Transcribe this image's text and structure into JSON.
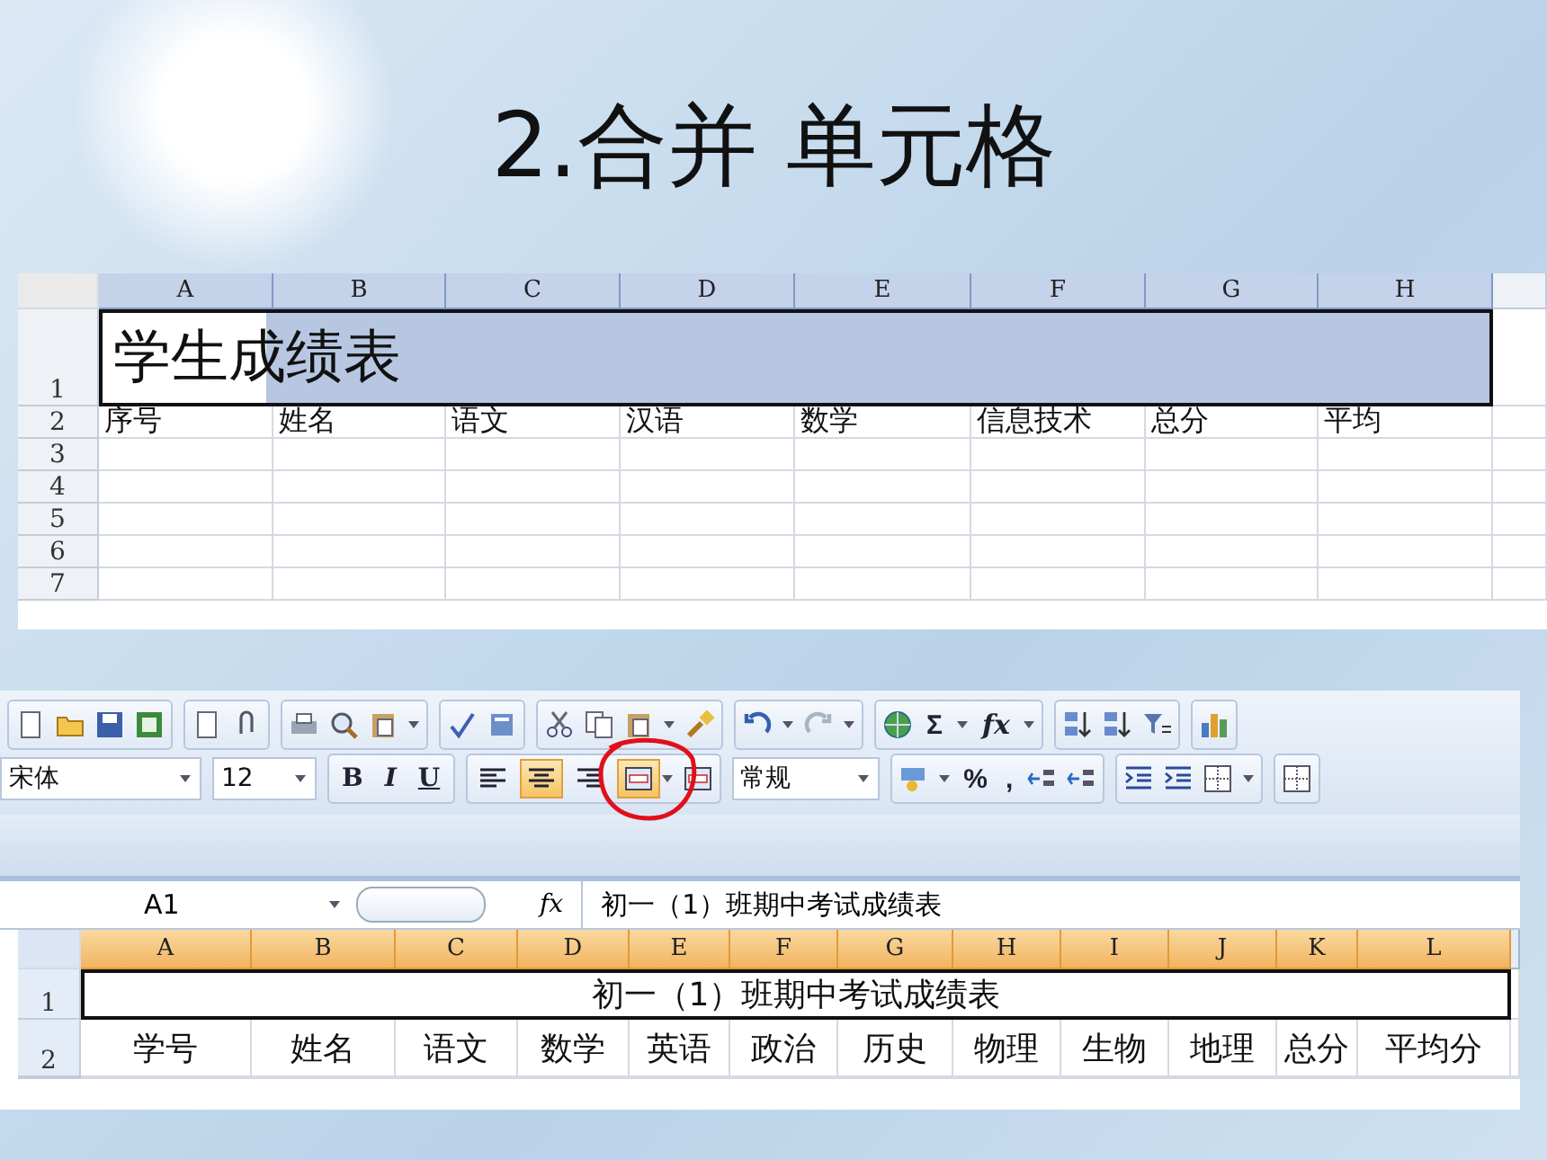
{
  "title": "2.合并 单元格",
  "sheet_1": {
    "columns": [
      {
        "label": "A",
        "selected": true
      },
      {
        "label": "B",
        "selected": true
      },
      {
        "label": "C",
        "selected": true
      },
      {
        "label": "D",
        "selected": true
      },
      {
        "label": "E",
        "selected": true
      },
      {
        "label": "F",
        "selected": true
      },
      {
        "label": "G",
        "selected": true
      },
      {
        "label": "H",
        "selected": true
      }
    ],
    "rows": [
      {
        "label": "1",
        "kind": "merged",
        "text": "学生成绩表",
        "selected": true
      },
      {
        "label": "2",
        "kind": "cells",
        "cells": [
          "序号",
          "姓名",
          "语文",
          "汉语",
          "数学",
          "信息技术",
          "总分",
          "平均"
        ]
      },
      {
        "label": "3",
        "kind": "cells"
      },
      {
        "label": "4",
        "kind": "cells"
      },
      {
        "label": "5",
        "kind": "cells"
      },
      {
        "label": "6",
        "kind": "cells"
      },
      {
        "label": "7",
        "kind": "cells"
      }
    ]
  },
  "toolbar": {
    "font": "宋体",
    "size": "12",
    "styles": [
      {
        "label": "B"
      },
      {
        "label": "I"
      },
      {
        "label": "U"
      }
    ],
    "alignment": [
      {
        "kind": "left",
        "selected": false
      },
      {
        "kind": "center",
        "selected": true
      },
      {
        "kind": "right",
        "selected": false
      },
      {
        "kind": "merge",
        "selected": true,
        "circled": true
      }
    ],
    "format": "常规",
    "sum": "Σ",
    "function": "fx",
    "percent": "%",
    "comma": ","
  },
  "formula_bar": {
    "cell": "A1",
    "function_label": "fx",
    "formula": "初一（1）班期中考试成绩表"
  },
  "sheet_2": {
    "columns": [
      {
        "label": "A",
        "selected": true
      },
      {
        "label": "B",
        "selected": true
      },
      {
        "label": "C",
        "selected": true
      },
      {
        "label": "D",
        "selected": true
      },
      {
        "label": "E",
        "selected": true
      },
      {
        "label": "F",
        "selected": true
      },
      {
        "label": "G",
        "selected": true
      },
      {
        "label": "H",
        "selected": true
      },
      {
        "label": "I",
        "selected": true
      },
      {
        "label": "J",
        "selected": true
      },
      {
        "label": "K",
        "selected": true
      },
      {
        "label": "L",
        "selected": true
      }
    ],
    "rows": [
      {
        "label": "1",
        "kind": "merged",
        "text": "初一（1）班期中考试成绩表",
        "selected": false
      },
      {
        "label": "2",
        "kind": "cells",
        "cells": [
          "学号",
          "姓名",
          "语文",
          "数学",
          "英语",
          "政治",
          "历史",
          "物理",
          "生物",
          "地理",
          "总分",
          "平均分"
        ]
      }
    ]
  }
}
